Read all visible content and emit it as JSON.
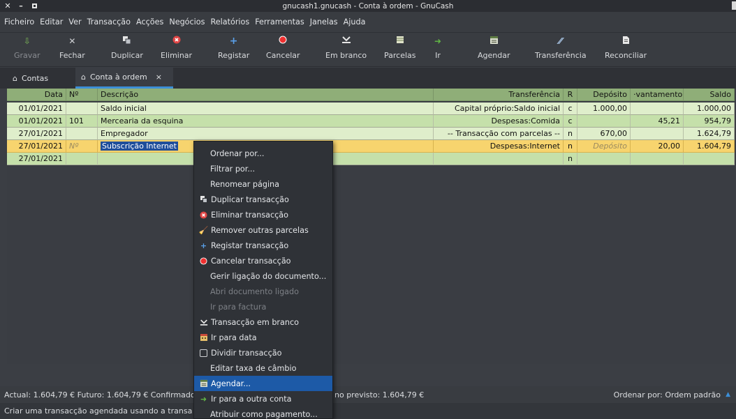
{
  "window": {
    "title": "gnucash1.gnucash - Conta à ordem - GnuCash"
  },
  "menubar": [
    "Ficheiro",
    "Editar",
    "Ver",
    "Transacção",
    "Acções",
    "Negócios",
    "Relatórios",
    "Ferramentas",
    "Janelas",
    "Ajuda"
  ],
  "toolbar": {
    "gravar": "Gravar",
    "fechar": "Fechar",
    "duplicar": "Duplicar",
    "eliminar": "Eliminar",
    "registar": "Registar",
    "cancelar": "Cancelar",
    "em_branco": "Em branco",
    "parcelas": "Parcelas",
    "ir": "Ir",
    "agendar": "Agendar",
    "transferencia": "Transferência",
    "reconciliar": "Reconciliar"
  },
  "tabs": [
    {
      "label": "Contas"
    },
    {
      "label": "Conta à ordem",
      "close": "×"
    }
  ],
  "register": {
    "columns": [
      "Data",
      "Nº",
      "Descrição",
      "Transferência",
      "R",
      "Depósito",
      "·vantamento",
      "Saldo"
    ],
    "rows": [
      {
        "date": "01/01/2021",
        "num": "",
        "desc": "Saldo inicial",
        "transfer": "Capital próprio:Saldo inicial",
        "r": "c",
        "deposit": "1.000,00",
        "withdrawal": "",
        "balance": "1.000,00"
      },
      {
        "date": "01/01/2021",
        "num": "101",
        "desc": "Mercearia da esquina",
        "transfer": "Despesas:Comida",
        "r": "c",
        "deposit": "",
        "withdrawal": "45,21",
        "balance": "954,79"
      },
      {
        "date": "27/01/2021",
        "num": "",
        "desc": "Empregador",
        "transfer": "-- Transacção com parcelas --",
        "r": "n",
        "deposit": "670,00",
        "withdrawal": "",
        "balance": "1.624,79"
      },
      {
        "date": "27/01/2021",
        "num": "Nº",
        "desc": "Subscrição Internet",
        "transfer": "Despesas:Internet",
        "r": "n",
        "deposit": "Depósito",
        "withdrawal": "20,00",
        "balance": "1.604,79"
      },
      {
        "date": "27/01/2021",
        "num": "",
        "desc": "",
        "transfer": "",
        "r": "n",
        "deposit": "",
        "withdrawal": "",
        "balance": ""
      }
    ]
  },
  "context_menu": [
    {
      "label": "Ordenar por...",
      "icon": ""
    },
    {
      "label": "Filtrar por...",
      "icon": ""
    },
    {
      "label": "Renomear página",
      "icon": ""
    },
    {
      "label": "Duplicar transacção",
      "icon": "duplicate-icon"
    },
    {
      "label": "Eliminar transacção",
      "icon": "delete-icon"
    },
    {
      "label": "Remover outras parcelas",
      "icon": "broom-icon"
    },
    {
      "label": "Registar transacção",
      "icon": "plus-icon"
    },
    {
      "label": "Cancelar transacção",
      "icon": "cancel-icon"
    },
    {
      "label": "Gerir ligação do documento...",
      "icon": ""
    },
    {
      "label": "Abri documento ligado",
      "icon": "",
      "disabled": true
    },
    {
      "label": "Ir para factura",
      "icon": "",
      "disabled": true
    },
    {
      "label": "Transacção em branco",
      "icon": "blank-icon"
    },
    {
      "label": "Ir para data",
      "icon": "calendar-icon"
    },
    {
      "label": "Dividir transacção",
      "icon": "checkbox-icon"
    },
    {
      "label": "Editar taxa de câmbio",
      "icon": ""
    },
    {
      "label": "Agendar...",
      "icon": "schedule-icon",
      "highlight": true
    },
    {
      "label": "Ir para a outra conta",
      "icon": "jump-icon"
    },
    {
      "label": "Atribuir como pagamento...",
      "icon": ""
    }
  ],
  "summary": {
    "left": "Actual: 1.604,79 €  Futuro: 1.604,79 €  Confirmado",
    "middle": "no previsto: 1.604,79 €",
    "right": "Ordenar por: Ordem padrão"
  },
  "statusbar": {
    "text": "Criar uma transacção agendada usando a transa"
  },
  "colors": {
    "accent": "#3c8fd8",
    "highlight": "#1d5aa7",
    "selected_row": "#f7d46e"
  }
}
